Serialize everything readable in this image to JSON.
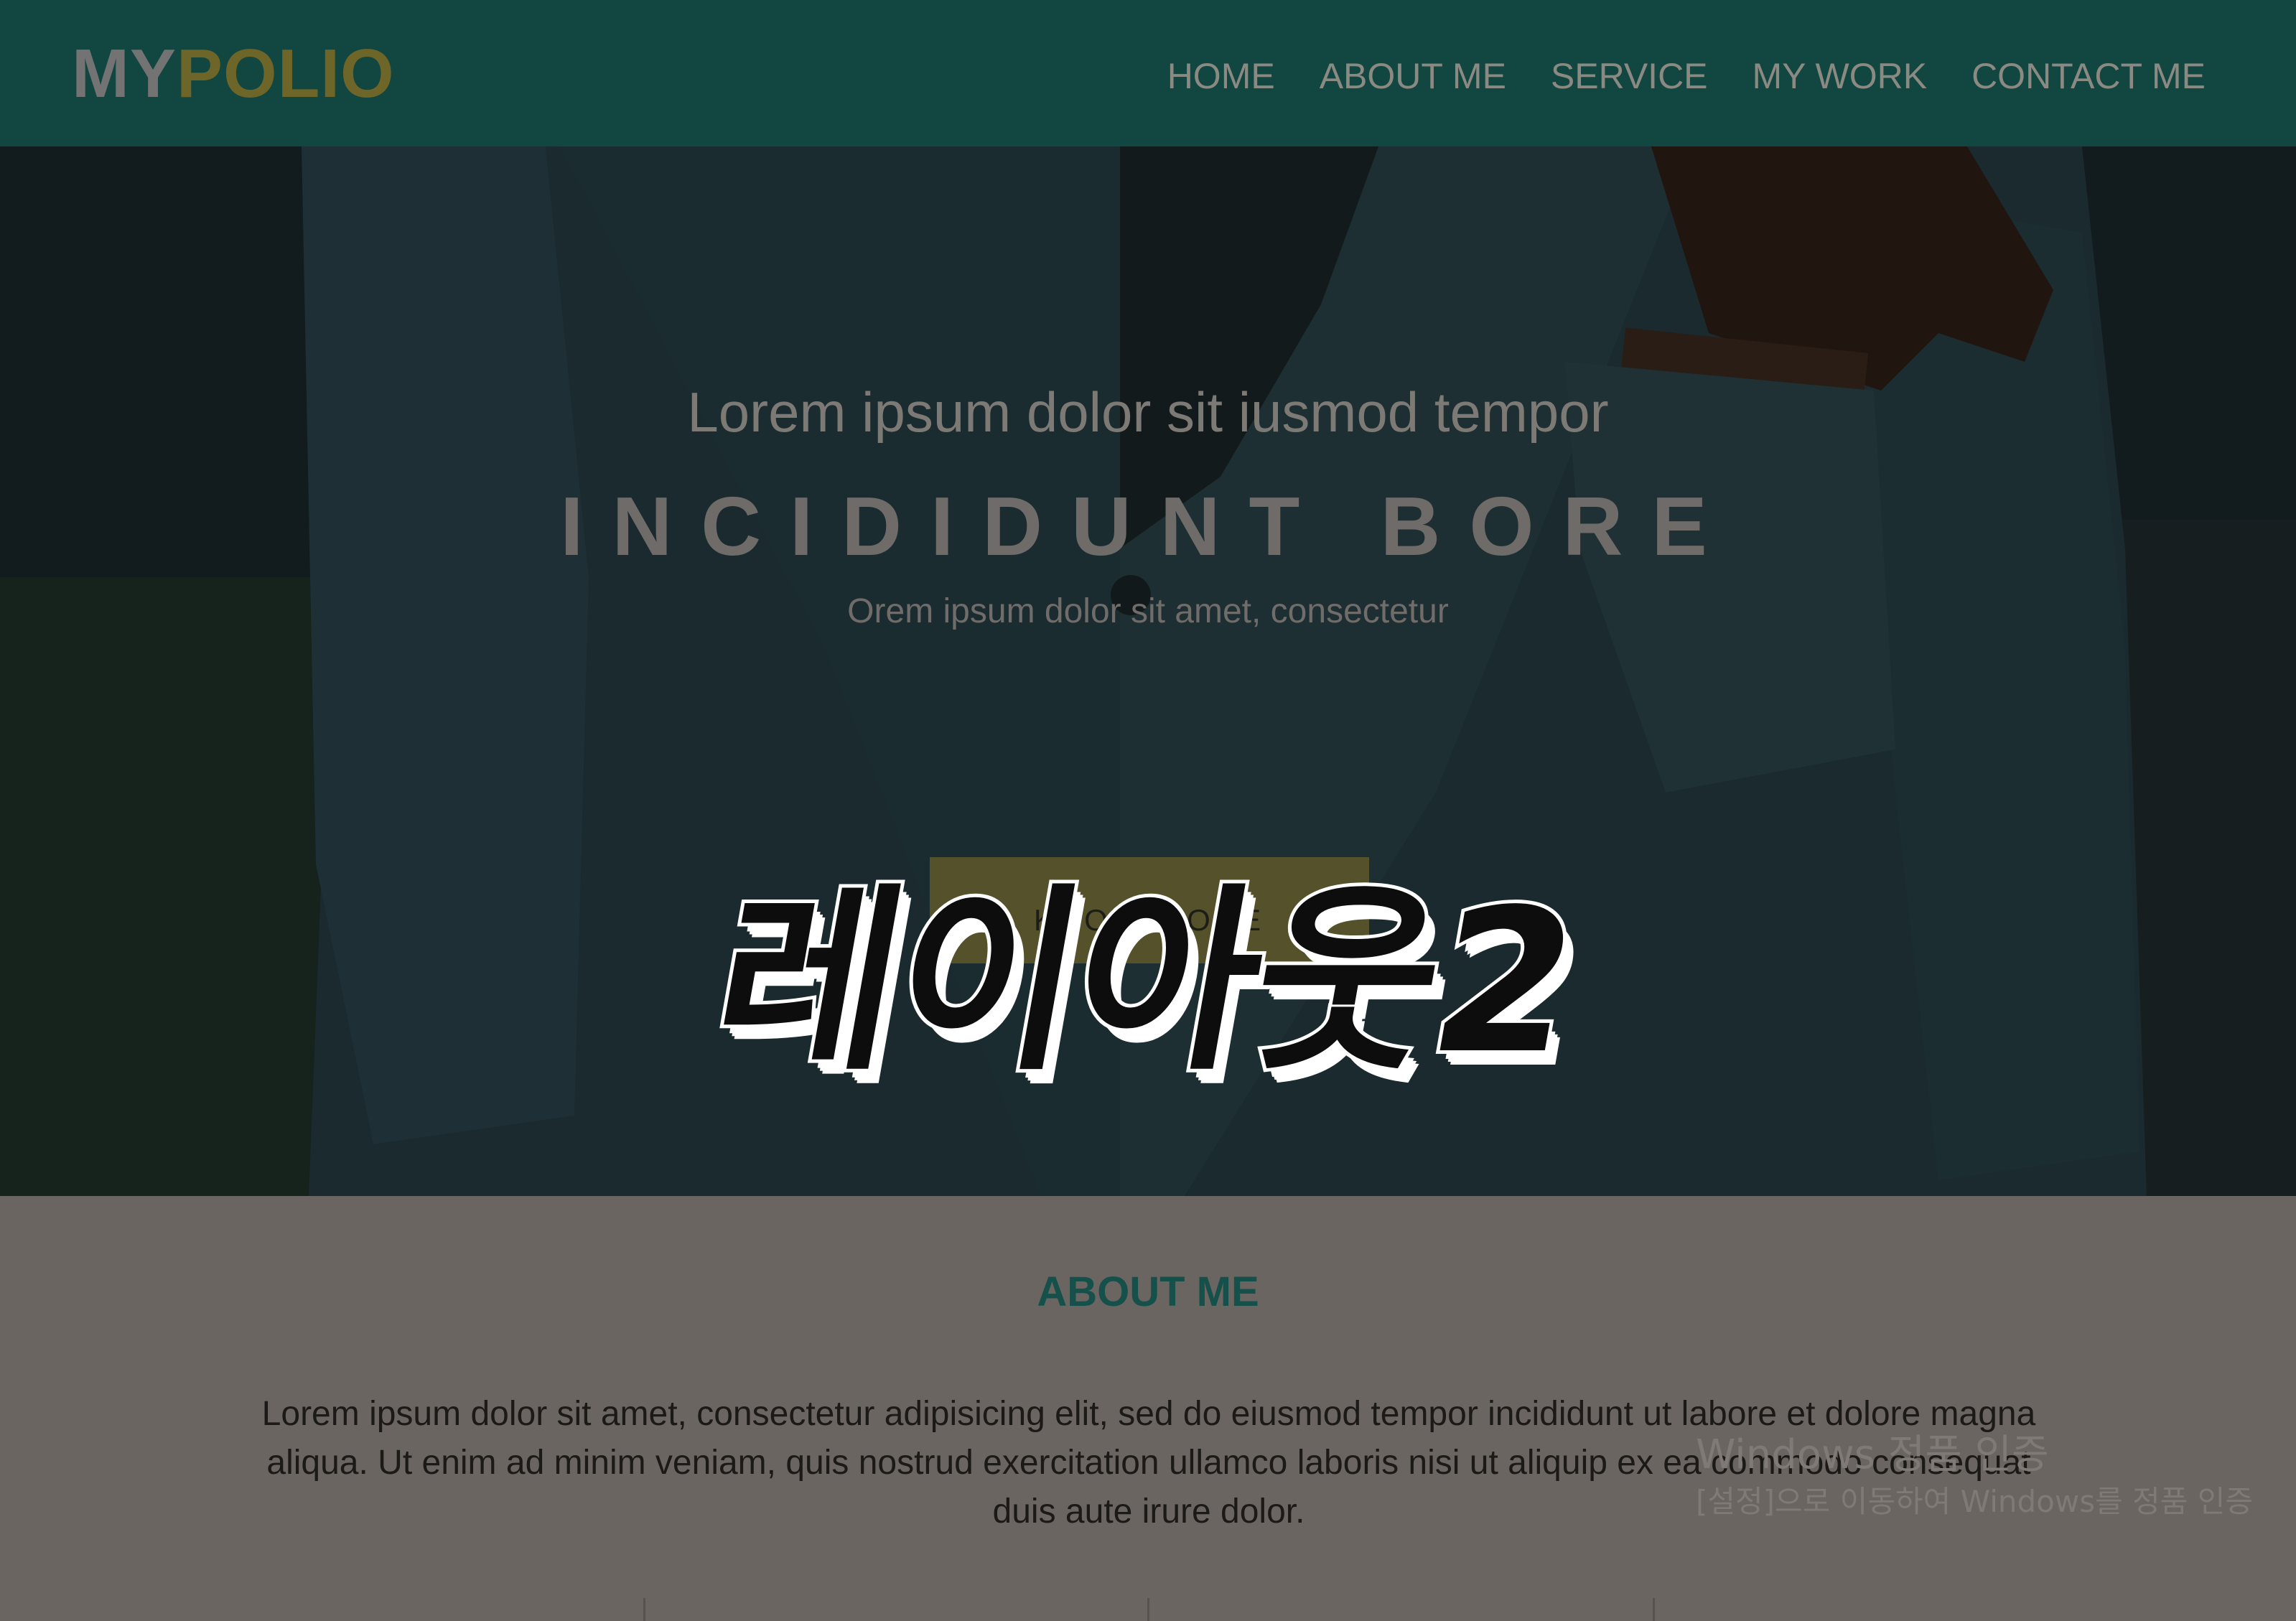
{
  "header": {
    "logo_my": "MY",
    "logo_polio": "POLIO",
    "nav": [
      "HOME",
      "ABOUT ME",
      "SERVICE",
      "MY WORK",
      "CONTACT ME"
    ]
  },
  "hero": {
    "line1": "Lorem ipsum dolor sit iusmod tempor",
    "line2": "INCIDIDUNT BORE",
    "line3": "Orem ipsum dolor sit amet, consectetur",
    "button": "KNOW MORE",
    "overlay_title": "레이아웃2"
  },
  "about": {
    "title": "ABOUT ME",
    "text": "Lorem ipsum dolor sit amet, consectetur adipisicing elit, sed do eiusmod tempor incididunt ut labore et dolore magna aliqua. Ut enim ad minim veniam, quis nostrud exercitation ullamco laboris nisi ut aliquip ex ea commodo consequat duis aute irure dolor."
  },
  "watermark": {
    "line1": "Windows 정품 인증",
    "line2": "[설정]으로 이동하여 Windows를 정품 인증"
  },
  "colors": {
    "nav_bg": "#114641",
    "accent_gold": "#6e6528",
    "about_title": "#15504a",
    "about_bg": "#6a6561"
  }
}
